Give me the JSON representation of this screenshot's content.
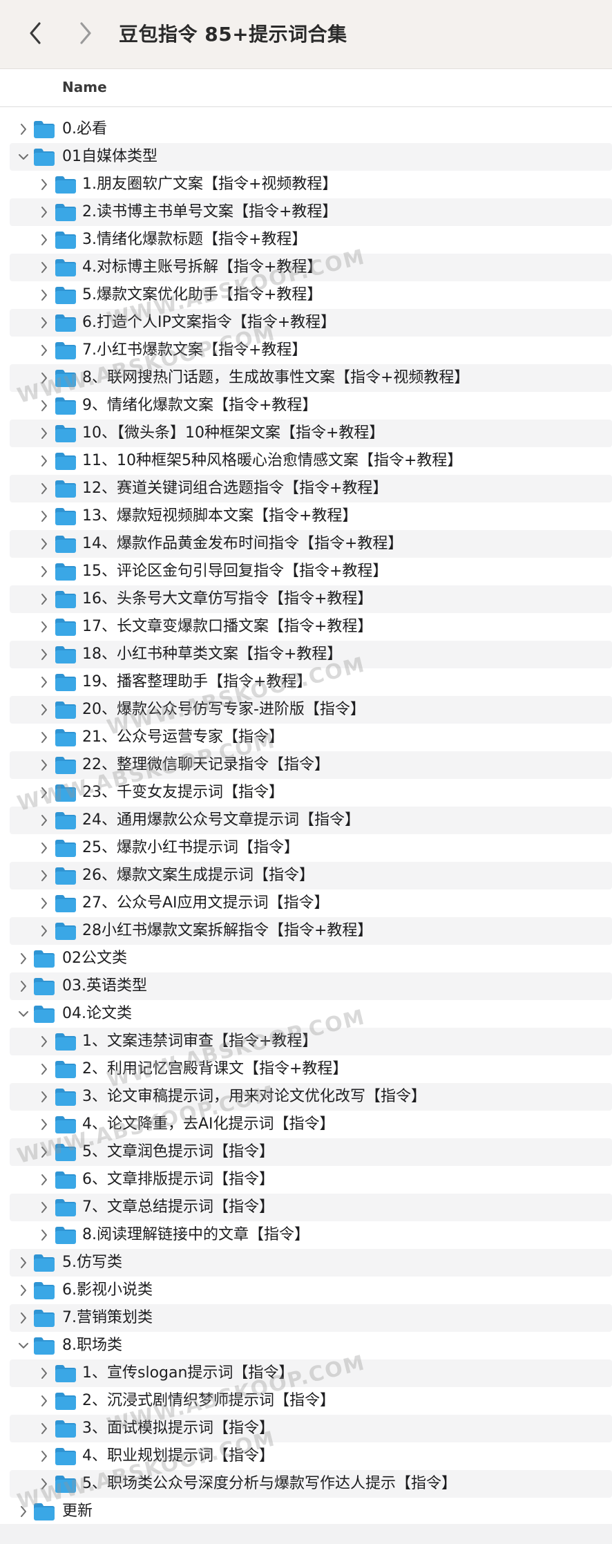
{
  "window": {
    "title": "豆包指令 85+提示词合集",
    "back_icon": "chevron-left-icon",
    "forward_icon": "chevron-right-icon"
  },
  "columns": {
    "name": "Name"
  },
  "colors": {
    "folder": "#3aa7e6",
    "folder_tab": "#2f94d3",
    "alt_row": "#f4f4f5",
    "titlebar": "#f4f1ee"
  },
  "watermark": "WWW.ABSKOOP.COM",
  "rows": [
    {
      "label": "0.必看",
      "depth": 0,
      "expanded": false
    },
    {
      "label": "01自媒体类型",
      "depth": 0,
      "expanded": true
    },
    {
      "label": "1.朋友圈软广文案【指令+视频教程】",
      "depth": 1,
      "expanded": false
    },
    {
      "label": "2.读书博主书单号文案【指令+教程】",
      "depth": 1,
      "expanded": false
    },
    {
      "label": "3.情绪化爆款标题【指令+教程】",
      "depth": 1,
      "expanded": false
    },
    {
      "label": "4.对标博主账号拆解【指令+教程】",
      "depth": 1,
      "expanded": false
    },
    {
      "label": "5.爆款文案优化助手【指令+教程】",
      "depth": 1,
      "expanded": false
    },
    {
      "label": "6.打造个人IP文案指令【指令+教程】",
      "depth": 1,
      "expanded": false
    },
    {
      "label": "7.小红书爆款文案【指令+教程】",
      "depth": 1,
      "expanded": false
    },
    {
      "label": "8、联网搜热门话题，生成故事性文案【指令+视频教程】",
      "depth": 1,
      "expanded": false
    },
    {
      "label": "9、情绪化爆款文案【指令+教程】",
      "depth": 1,
      "expanded": false
    },
    {
      "label": "10、【微头条】10种框架文案【指令+教程】",
      "depth": 1,
      "expanded": false
    },
    {
      "label": "11、10种框架5种风格暖心治愈情感文案【指令+教程】",
      "depth": 1,
      "expanded": false
    },
    {
      "label": "12、赛道关键词组合选题指令【指令+教程】",
      "depth": 1,
      "expanded": false
    },
    {
      "label": "13、爆款短视频脚本文案【指令+教程】",
      "depth": 1,
      "expanded": false
    },
    {
      "label": "14、爆款作品黄金发布时间指令【指令+教程】",
      "depth": 1,
      "expanded": false
    },
    {
      "label": "15、评论区金句引导回复指令【指令+教程】",
      "depth": 1,
      "expanded": false
    },
    {
      "label": "16、头条号大文章仿写指令【指令+教程】",
      "depth": 1,
      "expanded": false
    },
    {
      "label": "17、长文章变爆款口播文案【指令+教程】",
      "depth": 1,
      "expanded": false
    },
    {
      "label": "18、小红书种草类文案【指令+教程】",
      "depth": 1,
      "expanded": false
    },
    {
      "label": "19、播客整理助手【指令+教程】",
      "depth": 1,
      "expanded": false
    },
    {
      "label": "20、爆款公众号仿写专家-进阶版【指令】",
      "depth": 1,
      "expanded": false
    },
    {
      "label": "21、公众号运营专家【指令】",
      "depth": 1,
      "expanded": false
    },
    {
      "label": "22、整理微信聊天记录指令【指令】",
      "depth": 1,
      "expanded": false
    },
    {
      "label": "23、千变女友提示词【指令】",
      "depth": 1,
      "expanded": false
    },
    {
      "label": "24、通用爆款公众号文章提示词【指令】",
      "depth": 1,
      "expanded": false
    },
    {
      "label": "25、爆款小红书提示词【指令】",
      "depth": 1,
      "expanded": false
    },
    {
      "label": "26、爆款文案生成提示词【指令】",
      "depth": 1,
      "expanded": false
    },
    {
      "label": "27、公众号AI应用文提示词【指令】",
      "depth": 1,
      "expanded": false
    },
    {
      "label": "28小红书爆款文案拆解指令【指令+教程】",
      "depth": 1,
      "expanded": false
    },
    {
      "label": "02公文类",
      "depth": 0,
      "expanded": false
    },
    {
      "label": "03.英语类型",
      "depth": 0,
      "expanded": false
    },
    {
      "label": "04.论文类",
      "depth": 0,
      "expanded": true
    },
    {
      "label": "1、文案违禁词审查【指令+教程】",
      "depth": 1,
      "expanded": false
    },
    {
      "label": "2、利用记忆宫殿背课文【指令+教程】",
      "depth": 1,
      "expanded": false
    },
    {
      "label": "3、论文审稿提示词，用来对论文优化改写【指令】",
      "depth": 1,
      "expanded": false
    },
    {
      "label": "4、论文降重，去AI化提示词【指令】",
      "depth": 1,
      "expanded": false
    },
    {
      "label": "5、文章润色提示词【指令】",
      "depth": 1,
      "expanded": false
    },
    {
      "label": "6、文章排版提示词【指令】",
      "depth": 1,
      "expanded": false
    },
    {
      "label": "7、文章总结提示词【指令】",
      "depth": 1,
      "expanded": false
    },
    {
      "label": "8.阅读理解链接中的文章【指令】",
      "depth": 1,
      "expanded": false
    },
    {
      "label": "5.仿写类",
      "depth": 0,
      "expanded": false
    },
    {
      "label": "6.影视小说类",
      "depth": 0,
      "expanded": false
    },
    {
      "label": "7.营销策划类",
      "depth": 0,
      "expanded": false
    },
    {
      "label": "8.职场类",
      "depth": 0,
      "expanded": true
    },
    {
      "label": "1、宣传slogan提示词【指令】",
      "depth": 1,
      "expanded": false
    },
    {
      "label": "2、沉浸式剧情织梦师提示词【指令】",
      "depth": 1,
      "expanded": false
    },
    {
      "label": "3、面试模拟提示词【指令】",
      "depth": 1,
      "expanded": false
    },
    {
      "label": "4、职业规划提示词【指令】",
      "depth": 1,
      "expanded": false
    },
    {
      "label": "5、职场类公众号深度分析与爆款写作达人提示【指令】",
      "depth": 1,
      "expanded": false
    },
    {
      "label": "更新",
      "depth": 0,
      "expanded": false
    }
  ]
}
